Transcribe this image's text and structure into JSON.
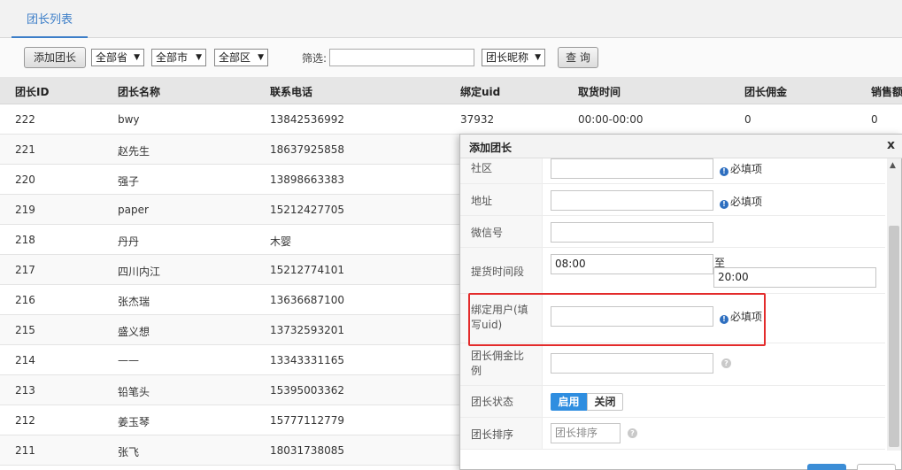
{
  "tabs": {
    "active": "团长列表"
  },
  "toolbar": {
    "add_button": "添加团长",
    "province": "全部省",
    "city": "全部市",
    "district": "全部区",
    "filter_label": "筛选:",
    "filter_value": "",
    "filter_field": "团长昵称",
    "query_button": "查 询"
  },
  "table": {
    "headers": [
      "团长ID",
      "团长名称",
      "联系电话",
      "绑定uid",
      "取货时间",
      "团长佣金",
      "销售额"
    ],
    "rows": [
      [
        "222",
        "bwy",
        "13842536992",
        "37932",
        "00:00-00:00",
        "0",
        "0"
      ],
      [
        "221",
        "赵先生",
        "18637925858",
        "",
        "",
        "",
        ""
      ],
      [
        "220",
        "强子",
        "13898663383",
        "",
        "",
        "",
        ""
      ],
      [
        "219",
        "paper",
        "15212427705",
        "",
        "",
        "",
        ""
      ],
      [
        "218",
        "丹丹",
        "木婴",
        "",
        "",
        "",
        ""
      ],
      [
        "217",
        "四川内江",
        "15212774101",
        "",
        "",
        "",
        ""
      ],
      [
        "216",
        "张杰瑞",
        "13636687100",
        "",
        "",
        "",
        ""
      ],
      [
        "215",
        "盛义想",
        "13732593201",
        "",
        "",
        "",
        ""
      ],
      [
        "214",
        "——",
        "13343331165",
        "",
        "",
        "",
        ""
      ],
      [
        "213",
        "铅笔头",
        "15395003362",
        "",
        "",
        "",
        ""
      ],
      [
        "212",
        "姜玉琴",
        "15777112779",
        "",
        "",
        "",
        ""
      ],
      [
        "211",
        "张飞",
        "18031738085",
        "",
        "",
        "",
        ""
      ]
    ]
  },
  "modal": {
    "title": "添加团长",
    "close": "x",
    "required_text": "必填项",
    "fields": {
      "community": {
        "label": "社区",
        "value": ""
      },
      "address": {
        "label": "地址",
        "value": ""
      },
      "wechat": {
        "label": "微信号",
        "value": ""
      },
      "pickup_time": {
        "label": "提货时间段",
        "from": "08:00",
        "to_label": "至",
        "to": "20:00"
      },
      "bind_user": {
        "label": "绑定用户(填写uid)",
        "value": ""
      },
      "commission": {
        "label": "团长佣金比例",
        "value": ""
      },
      "status": {
        "label": "团长状态",
        "on": "启用",
        "off": "关闭"
      },
      "sort": {
        "label": "团长排序",
        "placeholder": "团长排序"
      }
    }
  },
  "colors": {
    "accent": "#3c7ec8",
    "highlight": "#e32b2b",
    "toggle_on": "#2f8ee0"
  }
}
